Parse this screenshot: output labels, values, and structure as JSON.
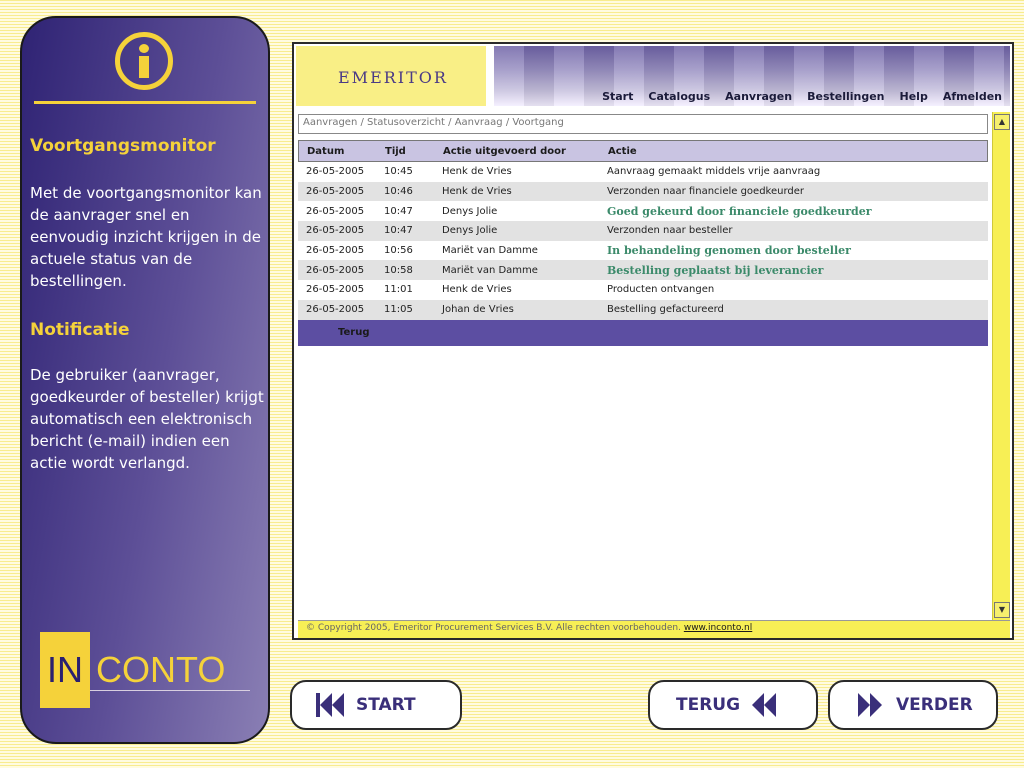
{
  "side_panel": {
    "heading1": "Voortgangsmonitor",
    "text1": "Met de voortgangsmonitor kan de aanvrager snel en eenvoudig inzicht krijgen in de actuele status van de bestellingen.",
    "heading2": "Notificatie",
    "text2": "De gebruiker (aanvrager, goedkeurder of besteller) krijgt automatisch een elektronisch bericht (e-mail) indien een actie wordt verlangd.",
    "brand_in": "IN",
    "brand_conto": "CONTO"
  },
  "app": {
    "logo": "EMERITOR",
    "nav": [
      "Start",
      "Catalogus",
      "Aanvragen",
      "Bestellingen",
      "Help",
      "Afmelden"
    ],
    "breadcrumb": "Aanvragen / Statusoverzicht / Aanvraag / Voortgang",
    "table": {
      "headers": [
        "Datum",
        "Tijd",
        "Actie uitgevoerd door",
        "Actie"
      ],
      "rows": [
        {
          "date": "26-05-2005",
          "time": "10:45",
          "by": "Henk de Vries",
          "action": "Aanvraag gemaakt middels vrije aanvraag"
        },
        {
          "date": "26-05-2005",
          "time": "10:46",
          "by": "Henk de Vries",
          "action": "Verzonden naar financiele goedkeurder"
        },
        {
          "date": "26-05-2005",
          "time": "10:47",
          "by": "Denys Jolie",
          "action": "Goed gekeurd door financiele goedkeurder"
        },
        {
          "date": "26-05-2005",
          "time": "10:47",
          "by": "Denys Jolie",
          "action": "Verzonden naar besteller"
        },
        {
          "date": "26-05-2005",
          "time": "10:56",
          "by": "Mariët van Damme",
          "action": "In behandeling genomen door besteller"
        },
        {
          "date": "26-05-2005",
          "time": "10:58",
          "by": "Mariët van Damme",
          "action": "Bestelling geplaatst bij leverancier"
        },
        {
          "date": "26-05-2005",
          "time": "11:01",
          "by": "Henk de Vries",
          "action": "Producten ontvangen"
        },
        {
          "date": "26-05-2005",
          "time": "11:05",
          "by": "Johan de Vries",
          "action": "Bestelling gefactureerd"
        }
      ],
      "back_label": "Terug"
    },
    "footer": {
      "copyright": "© Copyright 2005, Emeritor Procurement Services B.V. Alle rechten voorbehouden.",
      "link": "www.inconto.nl"
    }
  },
  "buttons": {
    "start": "START",
    "terug": "TERUG",
    "verder": "VERDER"
  },
  "colors": {
    "accent_yellow": "#f5d23a",
    "panel_purple": "#2f2374",
    "highlight_green": "#3b8a6a",
    "grid_footer": "#5c4ea2"
  }
}
